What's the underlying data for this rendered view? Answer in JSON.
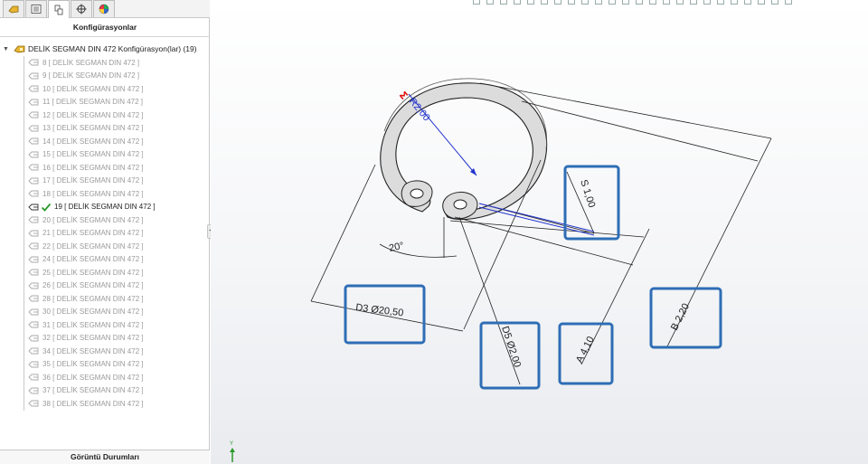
{
  "panel": {
    "tabs": [
      "feature-manager",
      "property-manager",
      "configuration-manager",
      "dimxpert-manager",
      "display-manager"
    ],
    "title": "Konfigürasyonlar",
    "root_label": "DELİK SEGMAN DIN 472 Konfigürasyon(lar)  (19)",
    "footer": "Görüntü Durumları",
    "items": [
      {
        "label": "8 [ DELİK SEGMAN DIN 472 ]"
      },
      {
        "label": "9 [ DELİK SEGMAN DIN 472 ]"
      },
      {
        "label": "10 [ DELİK SEGMAN DIN 472 ]"
      },
      {
        "label": "11 [ DELİK SEGMAN DIN 472 ]"
      },
      {
        "label": "12 [ DELİK SEGMAN DIN 472 ]"
      },
      {
        "label": "13 [ DELİK SEGMAN DIN 472 ]"
      },
      {
        "label": "14 [ DELİK SEGMAN DIN 472 ]"
      },
      {
        "label": "15 [ DELİK SEGMAN DIN 472 ]"
      },
      {
        "label": "16 [ DELİK SEGMAN DIN 472 ]"
      },
      {
        "label": "17 [ DELİK SEGMAN DIN 472 ]"
      },
      {
        "label": "18 [ DELİK SEGMAN DIN 472 ]"
      },
      {
        "label": "19 [ DELİK SEGMAN DIN 472 ]",
        "active": true
      },
      {
        "label": "20 [ DELİK SEGMAN DIN 472 ]"
      },
      {
        "label": "21 [ DELİK SEGMAN DIN 472 ]"
      },
      {
        "label": "22 [ DELİK SEGMAN DIN 472 ]"
      },
      {
        "label": "24 [ DELİK SEGMAN DIN 472 ]"
      },
      {
        "label": "25 [ DELİK SEGMAN DIN 472 ]"
      },
      {
        "label": "26 [ DELİK SEGMAN DIN 472 ]"
      },
      {
        "label": "28 [ DELİK SEGMAN DIN 472 ]"
      },
      {
        "label": "30 [ DELİK SEGMAN DIN 472 ]"
      },
      {
        "label": "31 [ DELİK SEGMAN DIN 472 ]"
      },
      {
        "label": "32 [ DELİK SEGMAN DIN 472 ]"
      },
      {
        "label": "34 [ DELİK SEGMAN DIN 472 ]"
      },
      {
        "label": "35 [ DELİK SEGMAN DIN 472 ]"
      },
      {
        "label": "36 [ DELİK SEGMAN DIN 472 ]"
      },
      {
        "label": "37 [ DELİK SEGMAN DIN 472 ]"
      },
      {
        "label": "38 [ DELİK SEGMAN DIN 472 ]"
      }
    ]
  },
  "viewport": {
    "axis_label": "Y",
    "dimensions": {
      "radius": "R2,00",
      "radius_symbol": "Σ",
      "angle": "20°",
      "d3": "D3  Ø20,50",
      "d5": "D5  Ø2,00",
      "s": "S  1,00",
      "a": "A  4,10",
      "b": "B  2,20"
    },
    "colors": {
      "highlight_box": "#2e6db5",
      "dim_line": "#222222",
      "radius_dim": "#2233cc",
      "radius_symbol": "#dd1111",
      "check": "#2a9a2a",
      "ring_face": "#dcdcdc"
    }
  }
}
